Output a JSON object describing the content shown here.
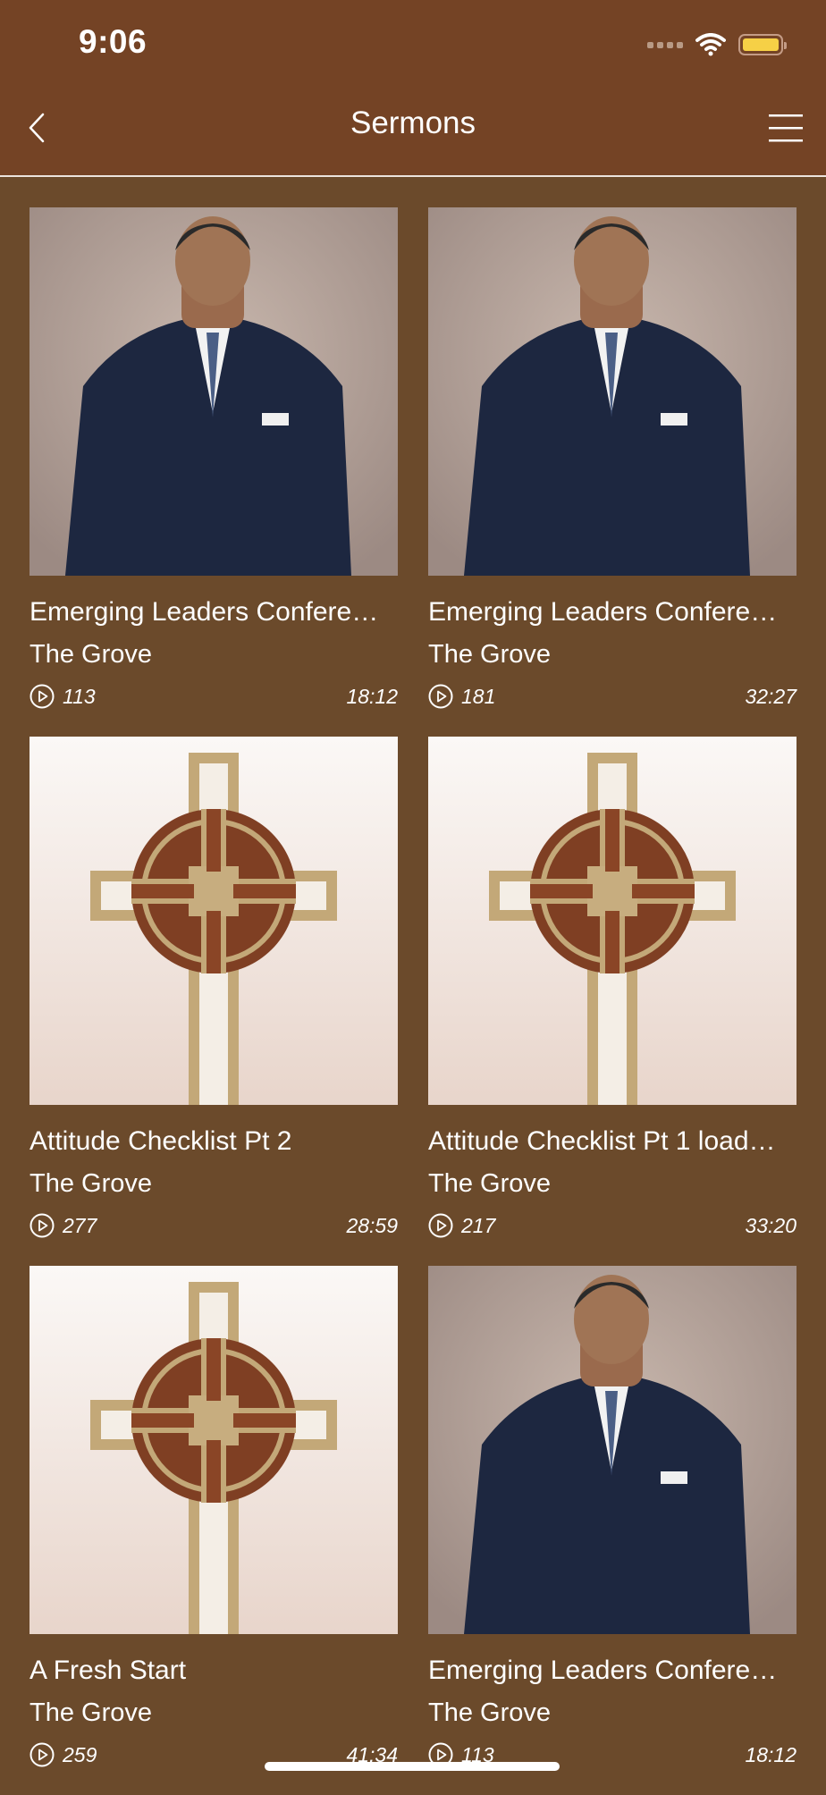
{
  "status": {
    "time": "9:06"
  },
  "nav": {
    "title": "Sermons"
  },
  "sermons": [
    {
      "title": "Emerging Leaders Confere…",
      "speaker": "The Grove",
      "plays": "113",
      "duration": "18:12",
      "thumb": "pastor-photo"
    },
    {
      "title": "Emerging Leaders Confere…",
      "speaker": "The Grove",
      "plays": "181",
      "duration": "32:27",
      "thumb": "pastor-photo"
    },
    {
      "title": "Attitude Checklist Pt 2",
      "speaker": "The Grove",
      "plays": "277",
      "duration": "28:59",
      "thumb": "cross-logo"
    },
    {
      "title": "Attitude Checklist Pt 1 load…",
      "speaker": "The Grove",
      "plays": "217",
      "duration": "33:20",
      "thumb": "cross-logo"
    },
    {
      "title": "A Fresh Start",
      "speaker": "The Grove",
      "plays": "259",
      "duration": "41:34",
      "thumb": "cross-logo"
    },
    {
      "title": "Emerging Leaders Confere…",
      "speaker": "The Grove",
      "plays": "113",
      "duration": "18:12",
      "thumb": "pastor-photo"
    }
  ],
  "colors": {
    "nav_bg": "#744325",
    "page_bg": "#6b4a2b",
    "battery": "#f6d046"
  }
}
